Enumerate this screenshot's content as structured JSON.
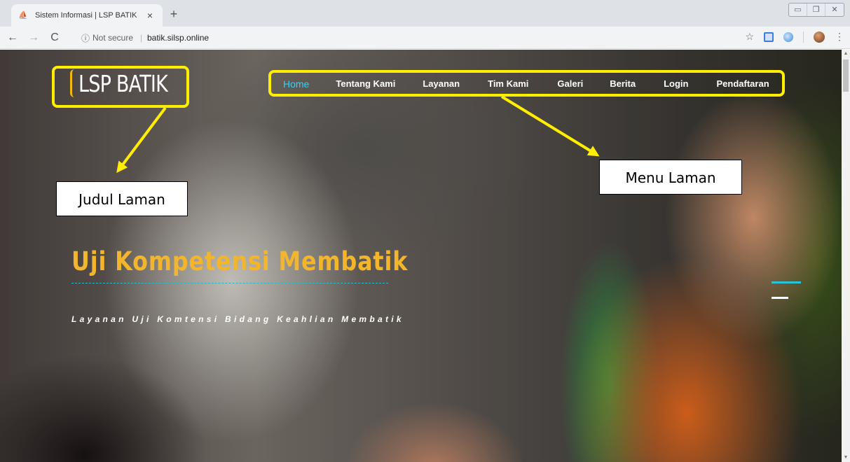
{
  "browser": {
    "tab_title": "Sistem Informasi | LSP BATIK",
    "tab_close": "×",
    "new_tab": "+",
    "security_label": "Not secure",
    "separator": "|",
    "url": "batik.silsp.online",
    "icons": [
      "back-icon",
      "forward-icon",
      "reload-icon",
      "info-icon",
      "star-icon",
      "extension-icon",
      "extension-icon",
      "profile-icon",
      "menu-icon"
    ]
  },
  "site": {
    "logo": "LSP BATIK",
    "nav": [
      {
        "label": "Home",
        "active": true
      },
      {
        "label": "Tentang Kami"
      },
      {
        "label": "Layanan"
      },
      {
        "label": "Tim Kami"
      },
      {
        "label": "Galeri"
      },
      {
        "label": "Berita"
      },
      {
        "label": "Login"
      },
      {
        "label": "Pendaftaran"
      }
    ],
    "hero": {
      "title": "Uji Kompetensi Membatik",
      "subtitle": "Layanan Uji Komtensi Bidang Keahlian Membatik"
    }
  },
  "annotations": {
    "judul": "Judul Laman",
    "menu": "Menu Laman"
  },
  "colors": {
    "highlight": "#ffee00",
    "hero_title": "#f3b52b",
    "nav_active": "#3ad0ee",
    "accent_line": "#2bb8d0"
  }
}
